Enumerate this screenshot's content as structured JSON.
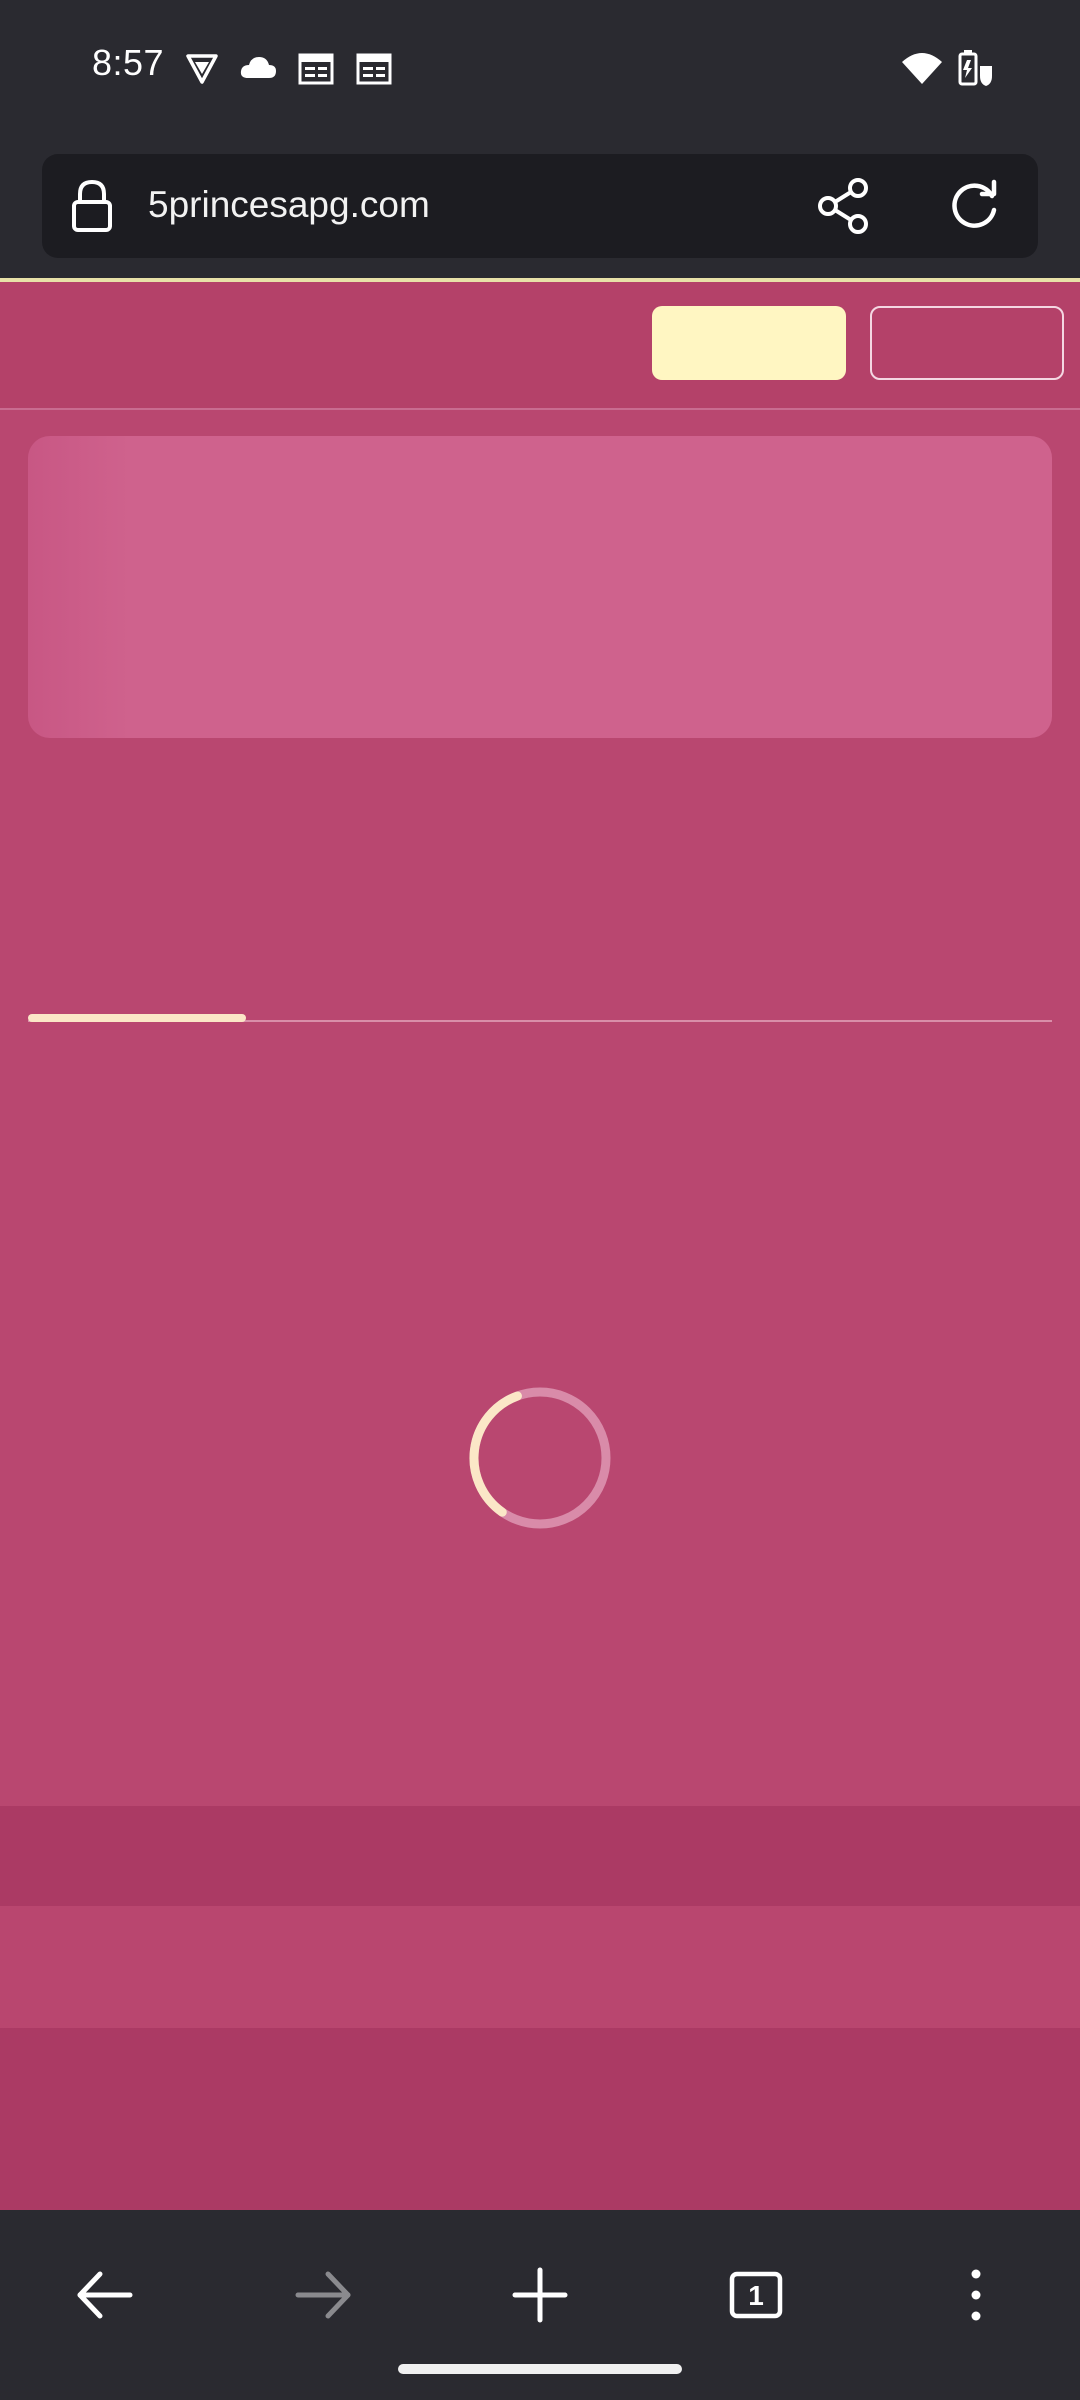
{
  "status_bar": {
    "time": "8:57",
    "left_icons": [
      "vpn-shield-icon",
      "cloud-icon",
      "calendar-icon",
      "calendar-icon"
    ],
    "right_icons": [
      "wifi-icon",
      "battery-saver-icon"
    ]
  },
  "browser": {
    "url": "5princesapg.com",
    "lock_icon": "lock-icon",
    "share_icon": "share-icon",
    "reload_icon": "reload-icon",
    "tab_count": "1"
  },
  "colors": {
    "page_background": "#b94770",
    "accent_button": "#fff6c2",
    "browser_chrome": "#2a2a30",
    "spinner_highlight": "#fbe7c7"
  },
  "bottom_nav": {
    "icons": [
      "back-arrow-icon",
      "forward-arrow-icon",
      "plus-icon",
      "tabs-icon",
      "more-vert-icon"
    ]
  }
}
